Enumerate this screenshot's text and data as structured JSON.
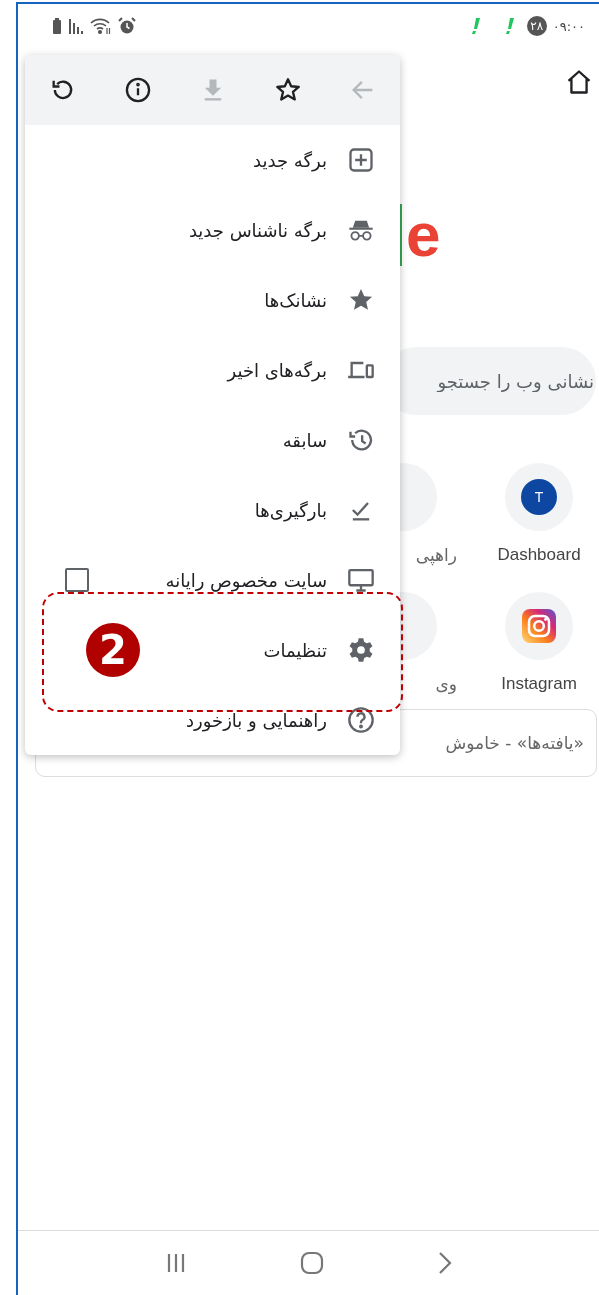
{
  "status_bar": {
    "badge": "۲۸",
    "time": "۰۹:۰۰"
  },
  "google_logo": {
    "letter": "e"
  },
  "search": {
    "placeholder": "نشانی وب را جستجو"
  },
  "shortcuts": [
    {
      "label": "Dashboard",
      "kind": "letter",
      "letter": "T"
    },
    {
      "label": "راهپی",
      "kind": "partial"
    },
    {
      "label": "Instagram",
      "kind": "instagram"
    },
    {
      "label": "وی",
      "kind": "partial"
    }
  ],
  "card": {
    "text": "«یافته‌ها» - خاموش"
  },
  "menu": {
    "actions": [
      {
        "disabled": false
      },
      {
        "disabled": false
      },
      {
        "disabled": true
      },
      {
        "disabled": false
      },
      {
        "disabled": true
      }
    ],
    "items": [
      {
        "label": "برگه جدید",
        "kind": "plain"
      },
      {
        "label": "برگه ناشناس جدید",
        "kind": "plain"
      },
      {
        "label": "نشانک‌ها",
        "kind": "plain"
      },
      {
        "label": "برگه‌های اخیر",
        "kind": "plain"
      },
      {
        "label": "سابقه",
        "kind": "plain"
      },
      {
        "label": "بارگیری‌ها",
        "kind": "plain"
      },
      {
        "label": "سایت مخصوص رایانه",
        "kind": "checkbox",
        "checked": false
      },
      {
        "label": "تنظیمات",
        "kind": "plain"
      },
      {
        "label": "راهنمایی و بازخورد",
        "kind": "plain"
      }
    ]
  },
  "annotation": {
    "number": "2"
  }
}
